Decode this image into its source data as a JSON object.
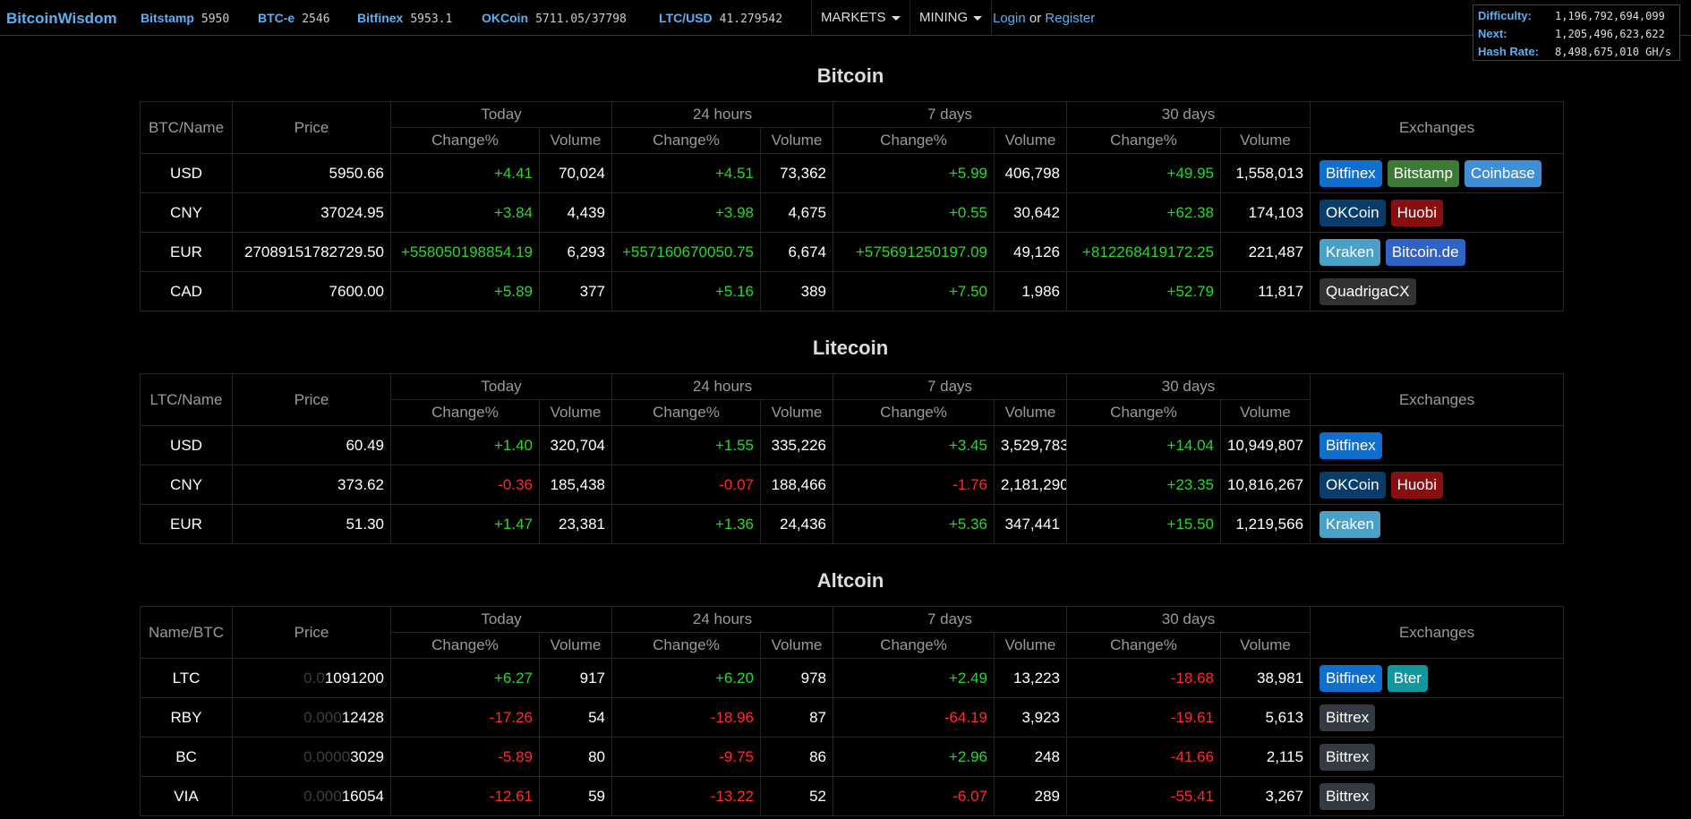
{
  "header": {
    "brand": "BitcoinWisdom",
    "tickers": [
      {
        "name": "Bitstamp",
        "value": "5950"
      },
      {
        "name": "BTC-e",
        "value": "2546"
      },
      {
        "name": "Bitfinex",
        "value": "5953.1"
      },
      {
        "name": "OKCoin",
        "value": "5711.05/37798"
      },
      {
        "name": "LTC/USD",
        "value": "41.279542"
      }
    ],
    "markets_label": "MARKETS",
    "mining_label": "MINING",
    "login_label": "Login",
    "or_label": "or",
    "register_label": "Register"
  },
  "difficulty": {
    "difficulty_label": "Difficulty:",
    "difficulty_value": "1,196,792,694,099",
    "next_label": "Next:",
    "next_value": "1,205,496,623,622",
    "hashrate_label": "Hash Rate:",
    "hashrate_value": "8,498,675,010 GH/s"
  },
  "columns": {
    "price": "Price",
    "today": "Today",
    "h24": "24 hours",
    "d7": "7 days",
    "d30": "30 days",
    "exchanges": "Exchanges",
    "change": "Change%",
    "volume": "Volume"
  },
  "sections": [
    {
      "title": "Bitcoin",
      "name_col": "BTC/Name",
      "rows": [
        {
          "name": "USD",
          "price": "5950.66",
          "today_ch": "+4.41",
          "today_vol": "70,024",
          "h24_ch": "+4.51",
          "h24_vol": "73,362",
          "d7_ch": "+5.99",
          "d7_vol": "406,798",
          "d30_ch": "+49.95",
          "d30_vol": "1,558,013",
          "exchanges": [
            "Bitfinex",
            "Bitstamp",
            "Coinbase"
          ]
        },
        {
          "name": "CNY",
          "price": "37024.95",
          "today_ch": "+3.84",
          "today_vol": "4,439",
          "h24_ch": "+3.98",
          "h24_vol": "4,675",
          "d7_ch": "+0.55",
          "d7_vol": "30,642",
          "d30_ch": "+62.38",
          "d30_vol": "174,103",
          "exchanges": [
            "OKCoin",
            "Huobi"
          ]
        },
        {
          "name": "EUR",
          "price": "27089151782729.50",
          "today_ch": "+558050198854.19",
          "today_vol": "6,293",
          "h24_ch": "+557160670050.75",
          "h24_vol": "6,674",
          "d7_ch": "+575691250197.09",
          "d7_vol": "49,126",
          "d30_ch": "+812268419172.25",
          "d30_vol": "221,487",
          "exchanges": [
            "Kraken",
            "Bitcoin.de"
          ]
        },
        {
          "name": "CAD",
          "price": "7600.00",
          "today_ch": "+5.89",
          "today_vol": "377",
          "h24_ch": "+5.16",
          "h24_vol": "389",
          "d7_ch": "+7.50",
          "d7_vol": "1,986",
          "d30_ch": "+52.79",
          "d30_vol": "11,817",
          "exchanges": [
            "QuadrigaCX"
          ]
        }
      ]
    },
    {
      "title": "Litecoin",
      "name_col": "LTC/Name",
      "rows": [
        {
          "name": "USD",
          "price": "60.49",
          "today_ch": "+1.40",
          "today_vol": "320,704",
          "h24_ch": "+1.55",
          "h24_vol": "335,226",
          "d7_ch": "+3.45",
          "d7_vol": "3,529,783",
          "d30_ch": "+14.04",
          "d30_vol": "10,949,807",
          "exchanges": [
            "Bitfinex"
          ]
        },
        {
          "name": "CNY",
          "price": "373.62",
          "today_ch": "-0.36",
          "today_vol": "185,438",
          "h24_ch": "-0.07",
          "h24_vol": "188,466",
          "d7_ch": "-1.76",
          "d7_vol": "2,181,290",
          "d30_ch": "+23.35",
          "d30_vol": "10,816,267",
          "exchanges": [
            "OKCoin",
            "Huobi"
          ]
        },
        {
          "name": "EUR",
          "price": "51.30",
          "today_ch": "+1.47",
          "today_vol": "23,381",
          "h24_ch": "+1.36",
          "h24_vol": "24,436",
          "d7_ch": "+5.36",
          "d7_vol": "347,441",
          "d30_ch": "+15.50",
          "d30_vol": "1,219,566",
          "exchanges": [
            "Kraken"
          ]
        }
      ]
    },
    {
      "title": "Altcoin",
      "name_col": "Name/BTC",
      "rows": [
        {
          "name": "LTC",
          "price_dim": "0.0",
          "price": "1091200",
          "today_ch": "+6.27",
          "today_vol": "917",
          "h24_ch": "+6.20",
          "h24_vol": "978",
          "d7_ch": "+2.49",
          "d7_vol": "13,223",
          "d30_ch": "-18.68",
          "d30_vol": "38,981",
          "exchanges": [
            "Bitfinex",
            "Bter"
          ]
        },
        {
          "name": "RBY",
          "price_dim": "0.000",
          "price": "12428",
          "today_ch": "-17.26",
          "today_vol": "54",
          "h24_ch": "-18.96",
          "h24_vol": "87",
          "d7_ch": "-64.19",
          "d7_vol": "3,923",
          "d30_ch": "-19.61",
          "d30_vol": "5,613",
          "exchanges": [
            "Bittrex"
          ]
        },
        {
          "name": "BC",
          "price_dim": "0.0000",
          "price": "3029",
          "today_ch": "-5.89",
          "today_vol": "80",
          "h24_ch": "-9.75",
          "h24_vol": "86",
          "d7_ch": "+2.96",
          "d7_vol": "248",
          "d30_ch": "-41.66",
          "d30_vol": "2,115",
          "exchanges": [
            "Bittrex"
          ]
        },
        {
          "name": "VIA",
          "price_dim": "0.000",
          "price": "16054",
          "today_ch": "-12.61",
          "today_vol": "59",
          "h24_ch": "-13.22",
          "h24_vol": "52",
          "d7_ch": "-6.07",
          "d7_vol": "289",
          "d30_ch": "-55.41",
          "d30_vol": "3,267",
          "exchanges": [
            "Bittrex"
          ]
        }
      ]
    }
  ],
  "colors": {
    "link": "#5bb0f3",
    "positive": "#2ed42e",
    "negative": "#ff2a2a",
    "background": "#000000"
  }
}
